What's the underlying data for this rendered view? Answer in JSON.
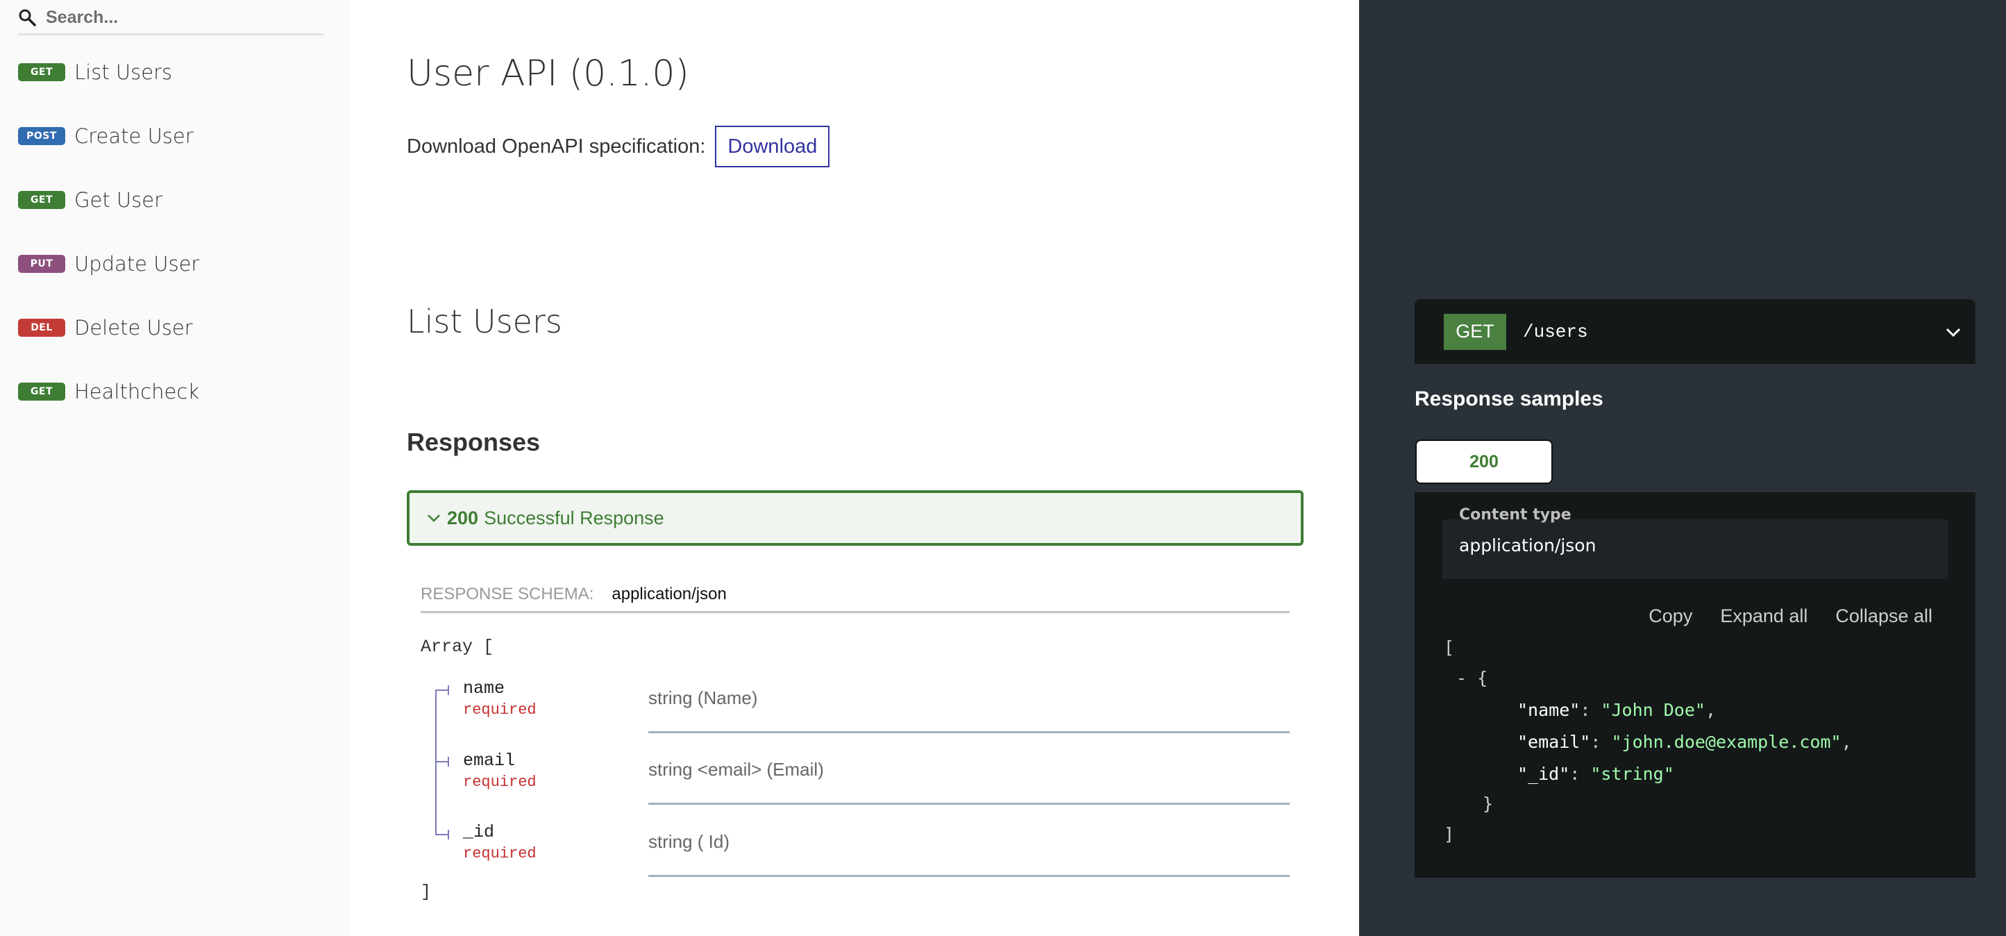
{
  "sidebar": {
    "search": {
      "placeholder": "Search...",
      "value": ""
    },
    "items": [
      {
        "method": "GET",
        "label": "List Users",
        "color": "#3f7d35"
      },
      {
        "method": "POST",
        "label": "Create User",
        "color": "#326cb0"
      },
      {
        "method": "GET",
        "label": "Get User",
        "color": "#3f7d35"
      },
      {
        "method": "PUT",
        "label": "Update User",
        "color": "#8d507d"
      },
      {
        "method": "DEL",
        "label": "Delete User",
        "color": "#c33b36"
      },
      {
        "method": "GET",
        "label": "Healthcheck",
        "color": "#3f7d35"
      }
    ]
  },
  "main": {
    "title": "User API (0.1.0)",
    "download_label": "Download OpenAPI specification:",
    "download_button": "Download",
    "operation_title": "List Users",
    "responses_title": "Responses",
    "response": {
      "code": "200",
      "description": "Successful Response"
    },
    "schema": {
      "label": "Response Schema:",
      "mime": "application/json",
      "open": "Array [",
      "close": "]",
      "fields": [
        {
          "name": "name",
          "required": "required",
          "type": "string (Name)"
        },
        {
          "name": "email",
          "required": "required",
          "type": "string <email> (Email)"
        },
        {
          "name": "_id",
          "required": "required",
          "type": "string ( Id)"
        }
      ]
    }
  },
  "right": {
    "endpoint": {
      "method": "GET",
      "path": "/users"
    },
    "samples_title": "Response samples",
    "tab": "200",
    "content_type_label": "Content type",
    "content_type_value": "application/json",
    "actions": {
      "copy": "Copy",
      "expand": "Expand all",
      "collapse": "Collapse all"
    },
    "json": {
      "open": "[",
      "obj_open": "- {",
      "lines": [
        {
          "key": "\"name\"",
          "value": "\"John Doe\"",
          "comma": ","
        },
        {
          "key": "\"email\"",
          "value": "\"john.doe@example.com\"",
          "comma": ","
        },
        {
          "key": "\"_id\"",
          "value": "\"string\"",
          "comma": ""
        }
      ],
      "obj_close": "}",
      "close": "]"
    }
  },
  "colors": {
    "get": "#3f7d35",
    "post": "#326cb0",
    "put": "#8d507d",
    "delete": "#c33b36",
    "link": "#32329f",
    "required": "#c53030",
    "json_string": "#a0fbaa"
  }
}
